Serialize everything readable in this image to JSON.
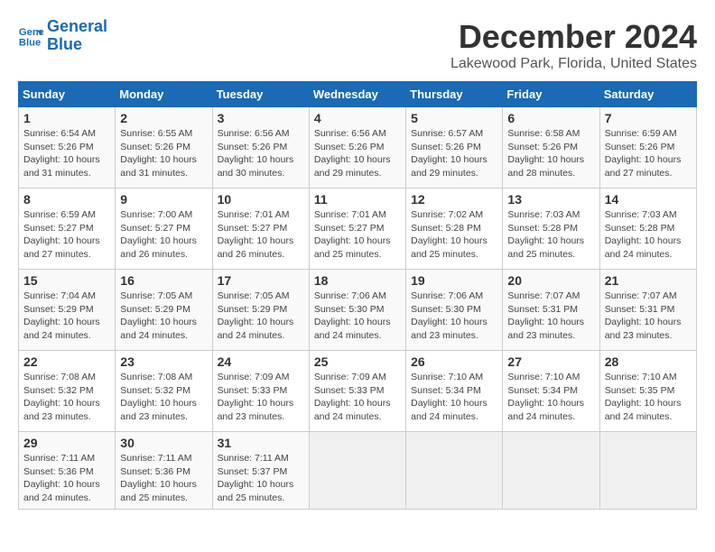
{
  "logo": {
    "line1": "General",
    "line2": "Blue"
  },
  "title": "December 2024",
  "subtitle": "Lakewood Park, Florida, United States",
  "weekdays": [
    "Sunday",
    "Monday",
    "Tuesday",
    "Wednesday",
    "Thursday",
    "Friday",
    "Saturday"
  ],
  "weeks": [
    [
      {
        "day": "1",
        "info": "Sunrise: 6:54 AM\nSunset: 5:26 PM\nDaylight: 10 hours\nand 31 minutes."
      },
      {
        "day": "2",
        "info": "Sunrise: 6:55 AM\nSunset: 5:26 PM\nDaylight: 10 hours\nand 31 minutes."
      },
      {
        "day": "3",
        "info": "Sunrise: 6:56 AM\nSunset: 5:26 PM\nDaylight: 10 hours\nand 30 minutes."
      },
      {
        "day": "4",
        "info": "Sunrise: 6:56 AM\nSunset: 5:26 PM\nDaylight: 10 hours\nand 29 minutes."
      },
      {
        "day": "5",
        "info": "Sunrise: 6:57 AM\nSunset: 5:26 PM\nDaylight: 10 hours\nand 29 minutes."
      },
      {
        "day": "6",
        "info": "Sunrise: 6:58 AM\nSunset: 5:26 PM\nDaylight: 10 hours\nand 28 minutes."
      },
      {
        "day": "7",
        "info": "Sunrise: 6:59 AM\nSunset: 5:26 PM\nDaylight: 10 hours\nand 27 minutes."
      }
    ],
    [
      {
        "day": "8",
        "info": "Sunrise: 6:59 AM\nSunset: 5:27 PM\nDaylight: 10 hours\nand 27 minutes."
      },
      {
        "day": "9",
        "info": "Sunrise: 7:00 AM\nSunset: 5:27 PM\nDaylight: 10 hours\nand 26 minutes."
      },
      {
        "day": "10",
        "info": "Sunrise: 7:01 AM\nSunset: 5:27 PM\nDaylight: 10 hours\nand 26 minutes."
      },
      {
        "day": "11",
        "info": "Sunrise: 7:01 AM\nSunset: 5:27 PM\nDaylight: 10 hours\nand 25 minutes."
      },
      {
        "day": "12",
        "info": "Sunrise: 7:02 AM\nSunset: 5:28 PM\nDaylight: 10 hours\nand 25 minutes."
      },
      {
        "day": "13",
        "info": "Sunrise: 7:03 AM\nSunset: 5:28 PM\nDaylight: 10 hours\nand 25 minutes."
      },
      {
        "day": "14",
        "info": "Sunrise: 7:03 AM\nSunset: 5:28 PM\nDaylight: 10 hours\nand 24 minutes."
      }
    ],
    [
      {
        "day": "15",
        "info": "Sunrise: 7:04 AM\nSunset: 5:29 PM\nDaylight: 10 hours\nand 24 minutes."
      },
      {
        "day": "16",
        "info": "Sunrise: 7:05 AM\nSunset: 5:29 PM\nDaylight: 10 hours\nand 24 minutes."
      },
      {
        "day": "17",
        "info": "Sunrise: 7:05 AM\nSunset: 5:29 PM\nDaylight: 10 hours\nand 24 minutes."
      },
      {
        "day": "18",
        "info": "Sunrise: 7:06 AM\nSunset: 5:30 PM\nDaylight: 10 hours\nand 24 minutes."
      },
      {
        "day": "19",
        "info": "Sunrise: 7:06 AM\nSunset: 5:30 PM\nDaylight: 10 hours\nand 23 minutes."
      },
      {
        "day": "20",
        "info": "Sunrise: 7:07 AM\nSunset: 5:31 PM\nDaylight: 10 hours\nand 23 minutes."
      },
      {
        "day": "21",
        "info": "Sunrise: 7:07 AM\nSunset: 5:31 PM\nDaylight: 10 hours\nand 23 minutes."
      }
    ],
    [
      {
        "day": "22",
        "info": "Sunrise: 7:08 AM\nSunset: 5:32 PM\nDaylight: 10 hours\nand 23 minutes."
      },
      {
        "day": "23",
        "info": "Sunrise: 7:08 AM\nSunset: 5:32 PM\nDaylight: 10 hours\nand 23 minutes."
      },
      {
        "day": "24",
        "info": "Sunrise: 7:09 AM\nSunset: 5:33 PM\nDaylight: 10 hours\nand 23 minutes."
      },
      {
        "day": "25",
        "info": "Sunrise: 7:09 AM\nSunset: 5:33 PM\nDaylight: 10 hours\nand 24 minutes."
      },
      {
        "day": "26",
        "info": "Sunrise: 7:10 AM\nSunset: 5:34 PM\nDaylight: 10 hours\nand 24 minutes."
      },
      {
        "day": "27",
        "info": "Sunrise: 7:10 AM\nSunset: 5:34 PM\nDaylight: 10 hours\nand 24 minutes."
      },
      {
        "day": "28",
        "info": "Sunrise: 7:10 AM\nSunset: 5:35 PM\nDaylight: 10 hours\nand 24 minutes."
      }
    ],
    [
      {
        "day": "29",
        "info": "Sunrise: 7:11 AM\nSunset: 5:36 PM\nDaylight: 10 hours\nand 24 minutes."
      },
      {
        "day": "30",
        "info": "Sunrise: 7:11 AM\nSunset: 5:36 PM\nDaylight: 10 hours\nand 25 minutes."
      },
      {
        "day": "31",
        "info": "Sunrise: 7:11 AM\nSunset: 5:37 PM\nDaylight: 10 hours\nand 25 minutes."
      },
      {
        "day": "",
        "info": ""
      },
      {
        "day": "",
        "info": ""
      },
      {
        "day": "",
        "info": ""
      },
      {
        "day": "",
        "info": ""
      }
    ]
  ]
}
